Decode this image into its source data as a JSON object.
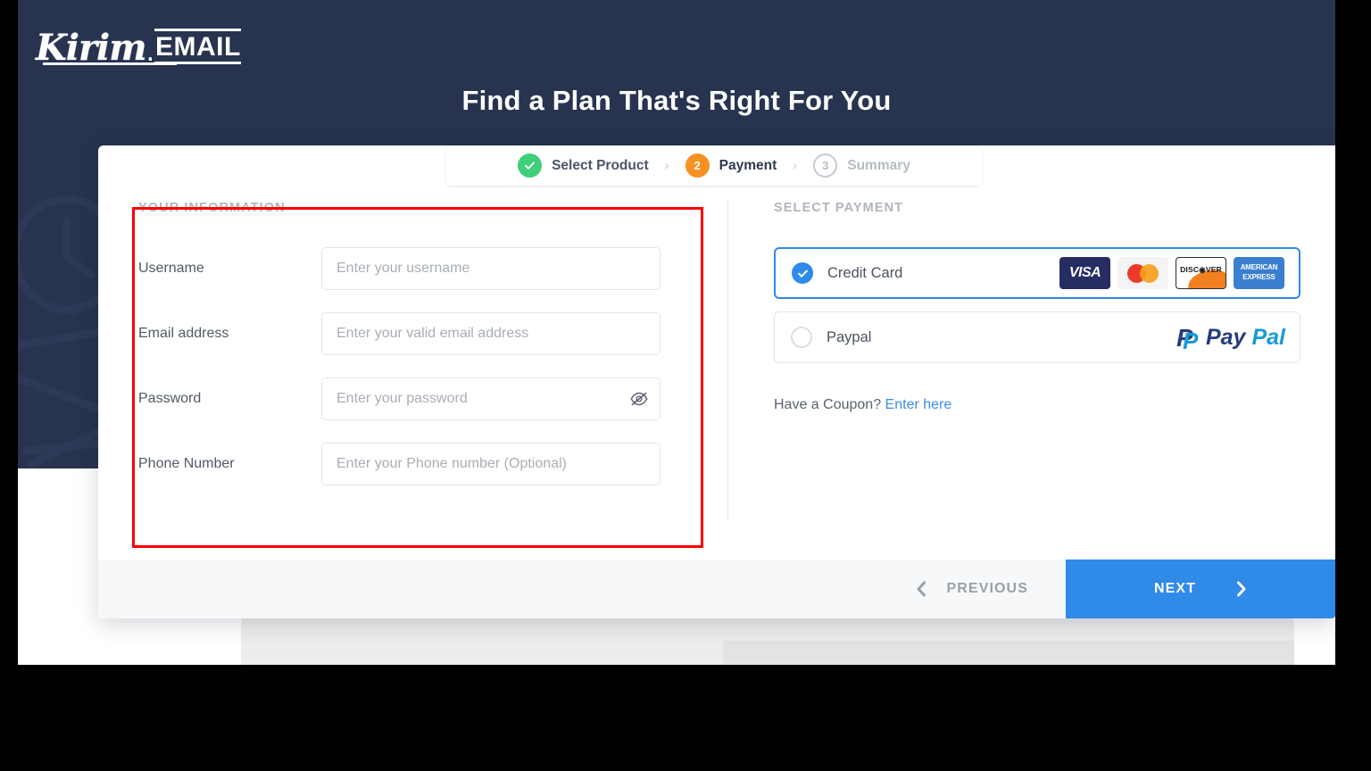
{
  "brand": {
    "logo_script": "Kirim",
    "logo_dot": ".",
    "logo_mail": "EMAIL"
  },
  "hero": {
    "title": "Find a Plan That's Right For You",
    "bg_color": "#27334f"
  },
  "stepper": {
    "steps": [
      {
        "marker": "✓",
        "label": "Select Product",
        "state": "done",
        "color": "#3ecf78"
      },
      {
        "marker": "2",
        "label": "Payment",
        "state": "active",
        "color": "#f59120"
      },
      {
        "marker": "3",
        "label": "Summary",
        "state": "todo",
        "color": "#c5cad3"
      }
    ],
    "separator": "›"
  },
  "form": {
    "section_title": "YOUR INFORMATION",
    "fields": [
      {
        "label": "Username",
        "placeholder": "Enter your username",
        "value": "",
        "type": "text"
      },
      {
        "label": "Email address",
        "placeholder": "Enter your valid email address",
        "value": "",
        "type": "email"
      },
      {
        "label": "Password",
        "placeholder": "Enter your password",
        "value": "",
        "type": "password"
      },
      {
        "label": "Phone Number",
        "placeholder": "Enter your Phone number (Optional)",
        "value": "",
        "type": "tel"
      }
    ]
  },
  "payment": {
    "section_title": "SELECT PAYMENT",
    "options": [
      {
        "label": "Credit Card",
        "selected": true,
        "logos": [
          "VISA",
          "Mastercard",
          "DISCOVER",
          "AMERICAN EXPRESS"
        ]
      },
      {
        "label": "Paypal",
        "selected": false,
        "logos": [
          "PayPal"
        ]
      }
    ],
    "card_logos": {
      "visa": "VISA",
      "discover": "DISC◉VER",
      "amex_line1": "AMERICAN",
      "amex_line2": "EXPRESS"
    },
    "paypal": {
      "mark": "P",
      "part1": "Pay",
      "part2": "Pal"
    },
    "coupon_text": "Have a Coupon?",
    "coupon_link": "Enter here"
  },
  "footer": {
    "previous_label": "PREVIOUS",
    "previous_icon": "chevron-left",
    "next_label": "NEXT",
    "next_icon": "chevron-right",
    "next_color": "#2f8ae8"
  },
  "annotation": {
    "color": "#fb0000"
  }
}
